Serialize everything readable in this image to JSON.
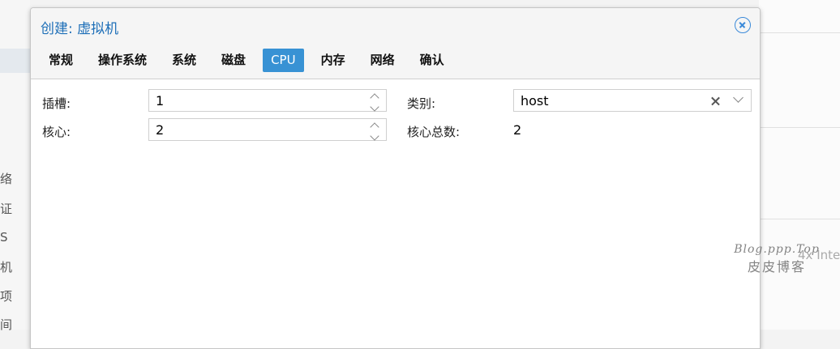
{
  "background": {
    "left_glyphs": [
      "络",
      "证",
      "S",
      "机",
      "项",
      "间"
    ],
    "right_text": "4x Inte"
  },
  "watermark": {
    "line1": "Blog.ppp.Top",
    "line2": "皮皮博客"
  },
  "dialog": {
    "title": "创建: 虚拟机",
    "tabs": [
      {
        "label": "常规",
        "active": false
      },
      {
        "label": "操作系统",
        "active": false
      },
      {
        "label": "系统",
        "active": false
      },
      {
        "label": "磁盘",
        "active": false
      },
      {
        "label": "CPU",
        "active": true
      },
      {
        "label": "内存",
        "active": false
      },
      {
        "label": "网络",
        "active": false
      },
      {
        "label": "确认",
        "active": false
      }
    ],
    "form": {
      "sockets_label": "插槽:",
      "sockets_value": "1",
      "cores_label": "核心:",
      "cores_value": "2",
      "type_label": "类别:",
      "type_value": "host",
      "total_cores_label": "核心总数:",
      "total_cores_value": "2"
    }
  }
}
